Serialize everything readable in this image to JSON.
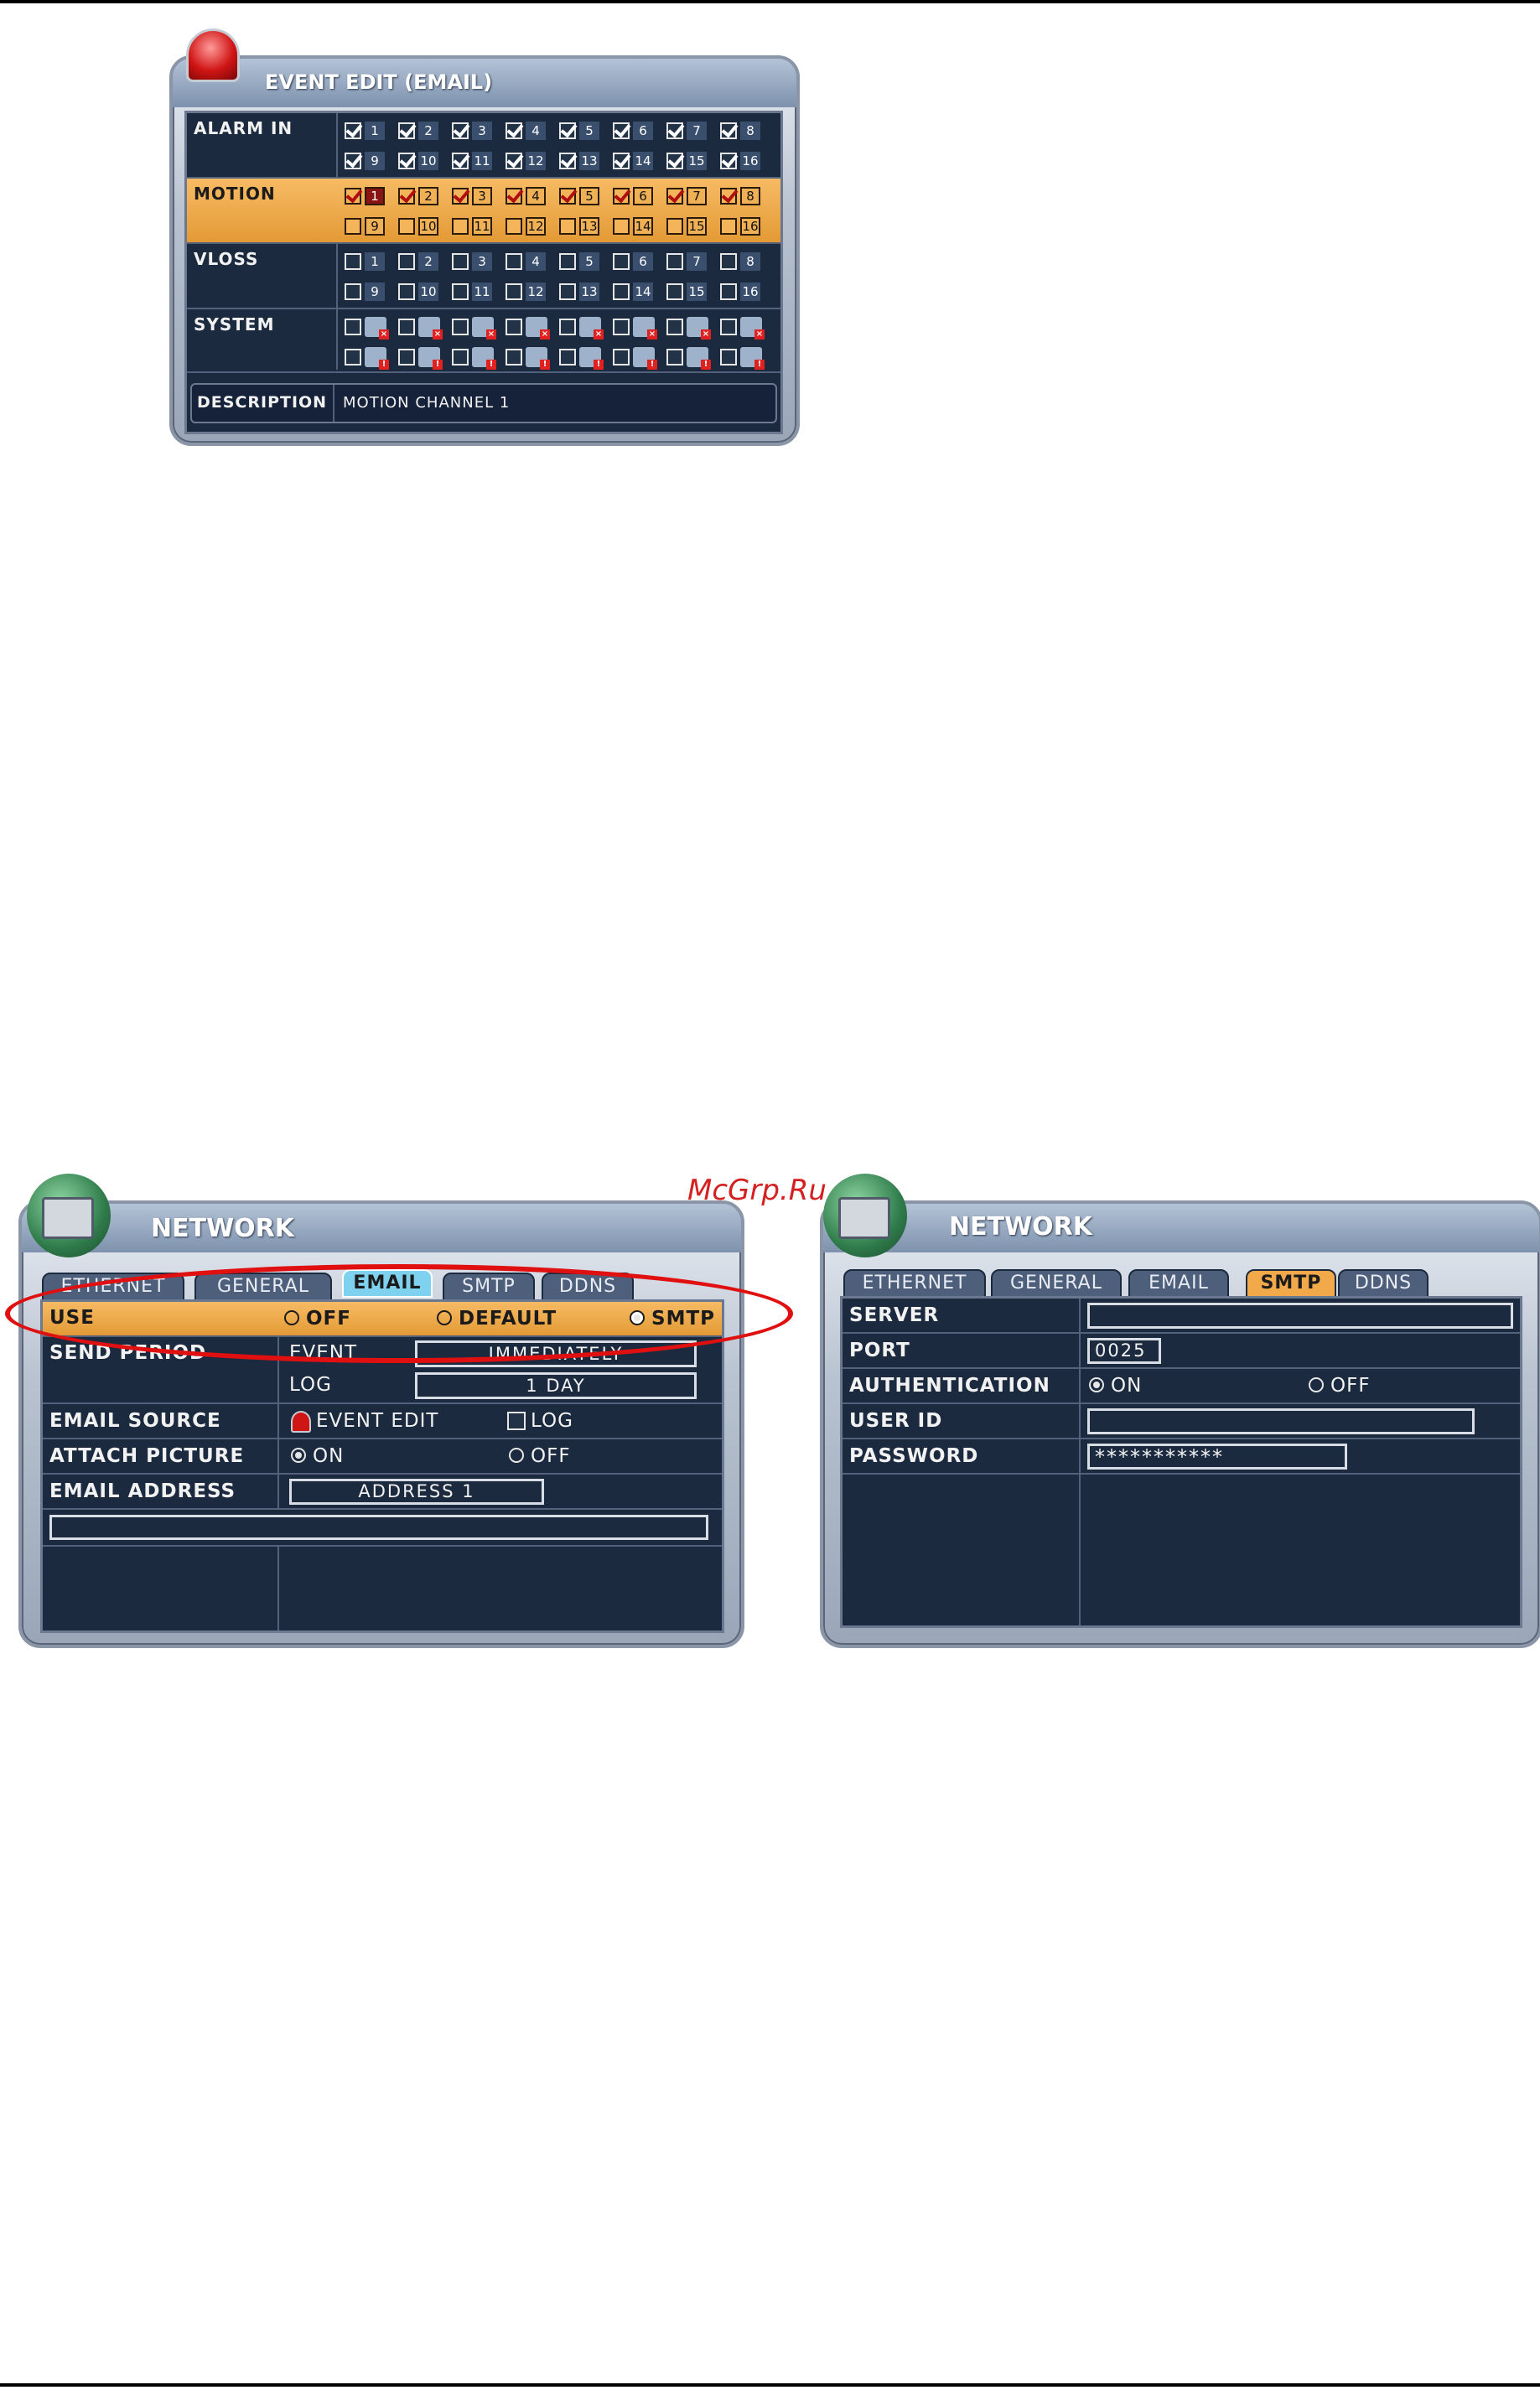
{
  "watermark": "McGrp.Ru",
  "event_edit": {
    "title": "EVENT EDIT (EMAIL)",
    "rows": {
      "alarm_in": "ALARM IN",
      "motion": "MOTION",
      "vloss": "VLOSS",
      "system": "SYSTEM"
    },
    "channels": [
      "1",
      "2",
      "3",
      "4",
      "5",
      "6",
      "7",
      "8",
      "9",
      "10",
      "11",
      "12",
      "13",
      "14",
      "15",
      "16"
    ],
    "alarm_in_checked": [
      true,
      true,
      true,
      true,
      true,
      true,
      true,
      true,
      true,
      true,
      true,
      true,
      true,
      true,
      true,
      true
    ],
    "motion_checked": [
      true,
      true,
      true,
      true,
      true,
      true,
      true,
      true,
      false,
      false,
      false,
      false,
      false,
      false,
      false,
      false
    ],
    "vloss_checked": [
      false,
      false,
      false,
      false,
      false,
      false,
      false,
      false,
      false,
      false,
      false,
      false,
      false,
      false,
      false,
      false
    ],
    "system_icons": [
      "printer-error-icon",
      "disk-error-icon",
      "hdd-error-icon",
      "fan-error-icon",
      "power-error-icon",
      "network-error-icon",
      "user-error-icon",
      "grid-error-icon",
      "user-alert-icon",
      "alert-icon",
      "alert-icon",
      "alert-icon",
      "alert-icon",
      "alert-icon",
      "alert-icon",
      "alert-icon"
    ],
    "description_label": "DESCRIPTION",
    "description_value": "MOTION CHANNEL 1"
  },
  "network_email": {
    "title": "NETWORK",
    "tabs": [
      "ETHERNET",
      "GENERAL",
      "EMAIL",
      "SMTP",
      "DDNS"
    ],
    "active_tab": "EMAIL",
    "use_label": "USE",
    "use_options": [
      "OFF",
      "DEFAULT",
      "SMTP"
    ],
    "use_selected": "SMTP",
    "send_period_label": "SEND PERIOD",
    "event_label": "EVENT",
    "event_value": "IMMEDIATELY",
    "log_label": "LOG",
    "log_value": "1 DAY",
    "email_source_label": "EMAIL SOURCE",
    "email_source_event": "EVENT EDIT",
    "email_source_log": "LOG",
    "attach_picture_label": "ATTACH PICTURE",
    "attach_on": "ON",
    "attach_off": "OFF",
    "email_address_label": "EMAIL ADDRESS",
    "email_address_value": "ADDRESS 1",
    "email_address_text": ""
  },
  "network_smtp": {
    "title": "NETWORK",
    "tabs": [
      "ETHERNET",
      "GENERAL",
      "EMAIL",
      "SMTP",
      "DDNS"
    ],
    "active_tab": "SMTP",
    "server_label": "SERVER",
    "server_value": "",
    "port_label": "PORT",
    "port_value": "0025",
    "auth_label": "AUTHENTICATION",
    "auth_on": "ON",
    "auth_off": "OFF",
    "user_id_label": "USER ID",
    "user_id_value": "",
    "password_label": "PASSWORD",
    "password_value": "***********"
  },
  "colors": {
    "panel_bg": "#1b2a3f",
    "highlight_orange": "#f2a94a",
    "annotation_red": "#e01010"
  }
}
